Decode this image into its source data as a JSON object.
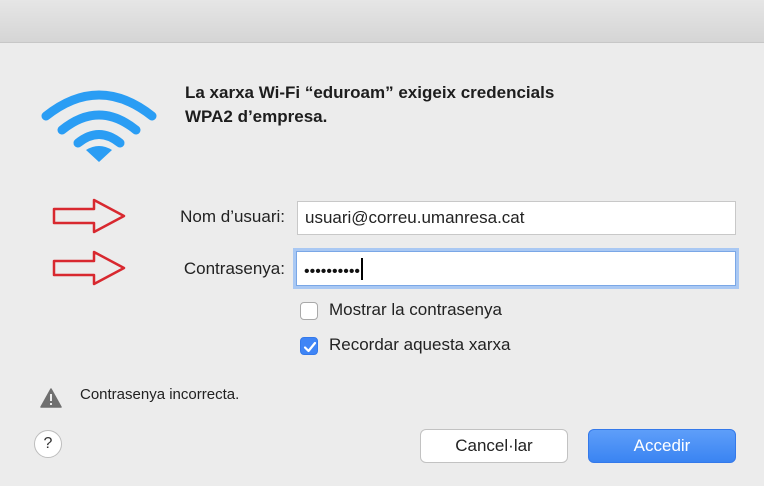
{
  "dialog": {
    "heading_line1": "La xarxa Wi-Fi “eduroam” exigeix credencials",
    "heading_line2": "WPA2 d’empresa.",
    "username_label": "Nom d’usuari:",
    "username_value": "usuari@correu.umanresa.cat",
    "password_label": "Contrasenya:",
    "password_mask": "••••••••••",
    "show_password_label": "Mostrar la contrasenya",
    "show_password_checked": false,
    "remember_network_label": "Recordar aquesta xarxa",
    "remember_network_checked": true,
    "error_message": "Contrasenya incorrecta.",
    "help_label": "?",
    "cancel_label": "Cancel·lar",
    "accept_label": "Accedir"
  },
  "colors": {
    "accent": "#3f85f6",
    "wifi": "#2a9df4",
    "annotation_arrow": "#d8282f"
  },
  "icons": [
    "wifi-icon",
    "annotation-arrow-icon",
    "checkmark-icon",
    "warning-icon"
  ]
}
